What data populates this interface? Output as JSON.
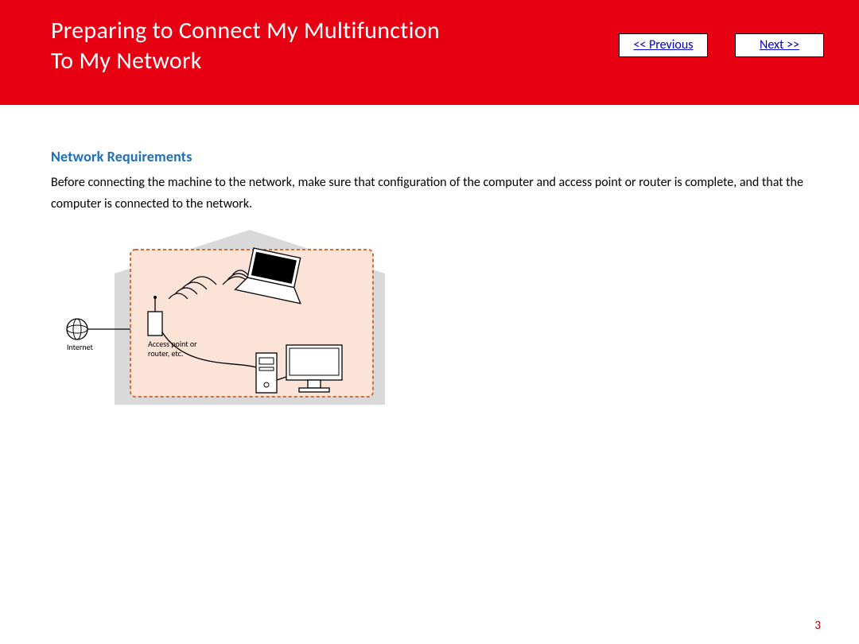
{
  "header": {
    "title_line1": "Preparing to Connect My Multifunction",
    "title_line2": "To My Network",
    "prev_label": "<< Previous",
    "next_label": "Next >>"
  },
  "content": {
    "section_heading": "Network Requirements",
    "paragraph": "Before connecting the machine to the network, make sure that configuration of the computer and access point or router is complete, and that the computer is connected to the network."
  },
  "diagram": {
    "internet_label": "Internet",
    "ap_label_line1": "Access point or",
    "ap_label_line2": "router, etc."
  },
  "footer": {
    "page_number": "3"
  }
}
